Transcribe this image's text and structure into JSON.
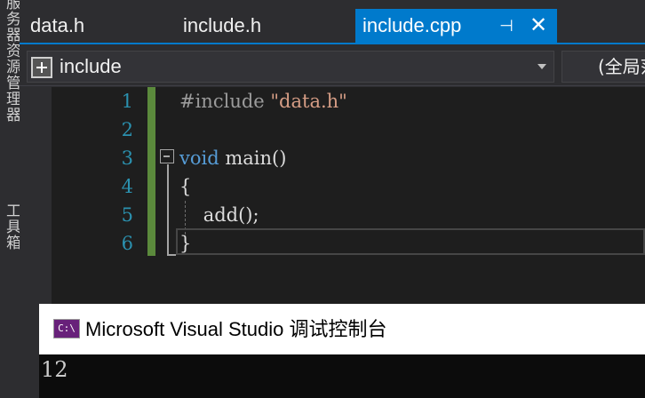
{
  "left_strip": {
    "text_top": "服务器资源管理器",
    "text_bottom": "工具箱"
  },
  "tabs": [
    {
      "label": "data.h",
      "active": false
    },
    {
      "label": "include.h",
      "active": false
    },
    {
      "label": "include.cpp",
      "active": true
    }
  ],
  "tab_icons": {
    "pin": "pin-icon",
    "close": "close-icon"
  },
  "nav": {
    "scope": "include",
    "member": "(全局范围)"
  },
  "editor": {
    "line_numbers": [
      "1",
      "2",
      "3",
      "4",
      "5",
      "6"
    ],
    "lines": {
      "l1_directive": "#include ",
      "l1_string": "\"data.h\"",
      "l3_keyword": "void",
      "l3_rest": " main()",
      "l4": "{",
      "l5": "    add();",
      "l6": "}"
    }
  },
  "console": {
    "icon_text": "C:\\",
    "title": "Microsoft Visual Studio 调试控制台",
    "output": "12"
  },
  "colors": {
    "accent": "#007acc",
    "keyword": "#569cd6",
    "string": "#d69d85",
    "line_number": "#2b91af",
    "change_bar": "#5b8a3c"
  }
}
